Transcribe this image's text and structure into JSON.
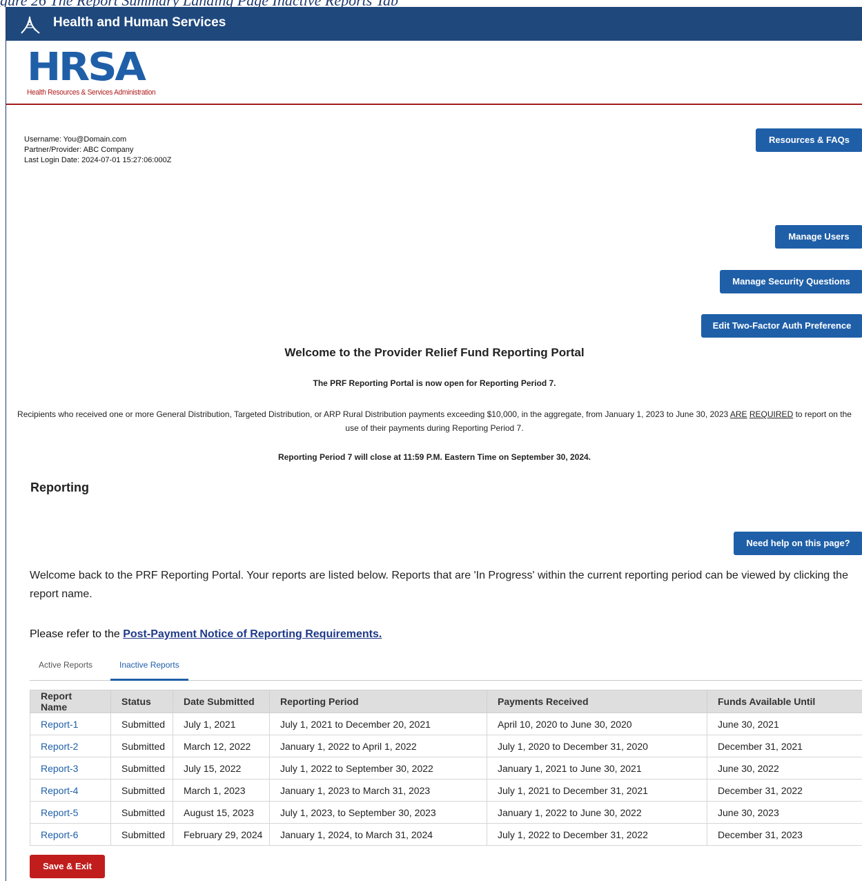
{
  "caption": "gure 26 The Report Summary Landing Page Inactive Reports Tab",
  "header": {
    "title": "Health and Human Services",
    "logo_text": "HRSA",
    "logo_subtitle": "Health Resources & Services Administration"
  },
  "user": {
    "username": "Username: You@Domain.com",
    "partner": "Partner/Provider: ABC Company",
    "last_login": "Last Login Date: 2024-07-01 15:27:06:000Z"
  },
  "buttons": {
    "resources": "Resources & FAQs",
    "manage_users": "Manage Users",
    "manage_security": "Manage Security Questions",
    "two_factor": "Edit Two-Factor Auth Preference",
    "need_help": "Need help on this page?",
    "save_exit": "Save & Exit"
  },
  "welcome": {
    "title": "Welcome to the Provider Relief Fund Reporting Portal",
    "open_line": "The PRF Reporting Portal is now open for Reporting Period 7.",
    "recipients_pre": "Recipients who received one or more General Distribution, Targeted Distribution, or ARP Rural Distribution payments exceeding $10,000, in the aggregate, from January 1, 2023 to June 30, 2023 ",
    "recipients_are": "ARE",
    "recipients_required": "REQUIRED",
    "recipients_post": " to report on the use of their payments during Reporting Period 7.",
    "close_line": "Reporting Period 7 will close at 11:59 P.M. Eastern Time on September 30, 2024."
  },
  "reporting": {
    "heading": "Reporting",
    "intro": "Welcome back to the PRF Reporting Portal. Your reports are listed below. Reports that are 'In Progress' within the current reporting period can be viewed by clicking the report name.",
    "refer_prefix": "Please refer to the ",
    "refer_link": "Post-Payment Notice of Reporting Requirements."
  },
  "tabs": [
    {
      "label": "Active Reports",
      "active": false
    },
    {
      "label": "Inactive Reports",
      "active": true
    }
  ],
  "table": {
    "headers": [
      "Report Name",
      "Status",
      "Date Submitted",
      "Reporting Period",
      "Payments Received",
      "Funds Available Until"
    ],
    "rows": [
      [
        "Report-1",
        "Submitted",
        "July 1, 2021",
        "July 1, 2021 to December 20, 2021",
        "April 10, 2020 to June 30, 2020",
        "June 30, 2021"
      ],
      [
        "Report-2",
        "Submitted",
        "March 12, 2022",
        "January 1, 2022 to April 1, 2022",
        "July 1, 2020 to December 31, 2020",
        "December 31, 2021"
      ],
      [
        "Report-3",
        "Submitted",
        "July 15, 2022",
        "July 1, 2022 to September 30, 2022",
        "January 1, 2021 to June 30, 2021",
        "June 30, 2022"
      ],
      [
        "Report-4",
        "Submitted",
        "March 1, 2023",
        "January 1, 2023 to March 31, 2023",
        "July 1, 2021 to December 31, 2021",
        "December 31, 2022"
      ],
      [
        "Report-5",
        "Submitted",
        "August 15, 2023",
        "July 1, 2023, to September 30, 2023",
        "January 1, 2022 to June 30, 2022",
        "June 30, 2023"
      ],
      [
        "Report-6",
        "Submitted",
        "February 29, 2024",
        "January 1, 2024, to March 31, 2024",
        "July 1, 2022 to December 31, 2022",
        "December 31, 2023"
      ]
    ]
  },
  "colors": {
    "header_bar": "#1f497d",
    "primary_button": "#1f5fa8",
    "danger_button": "#c11d1d",
    "rule": "#a11c1c"
  }
}
